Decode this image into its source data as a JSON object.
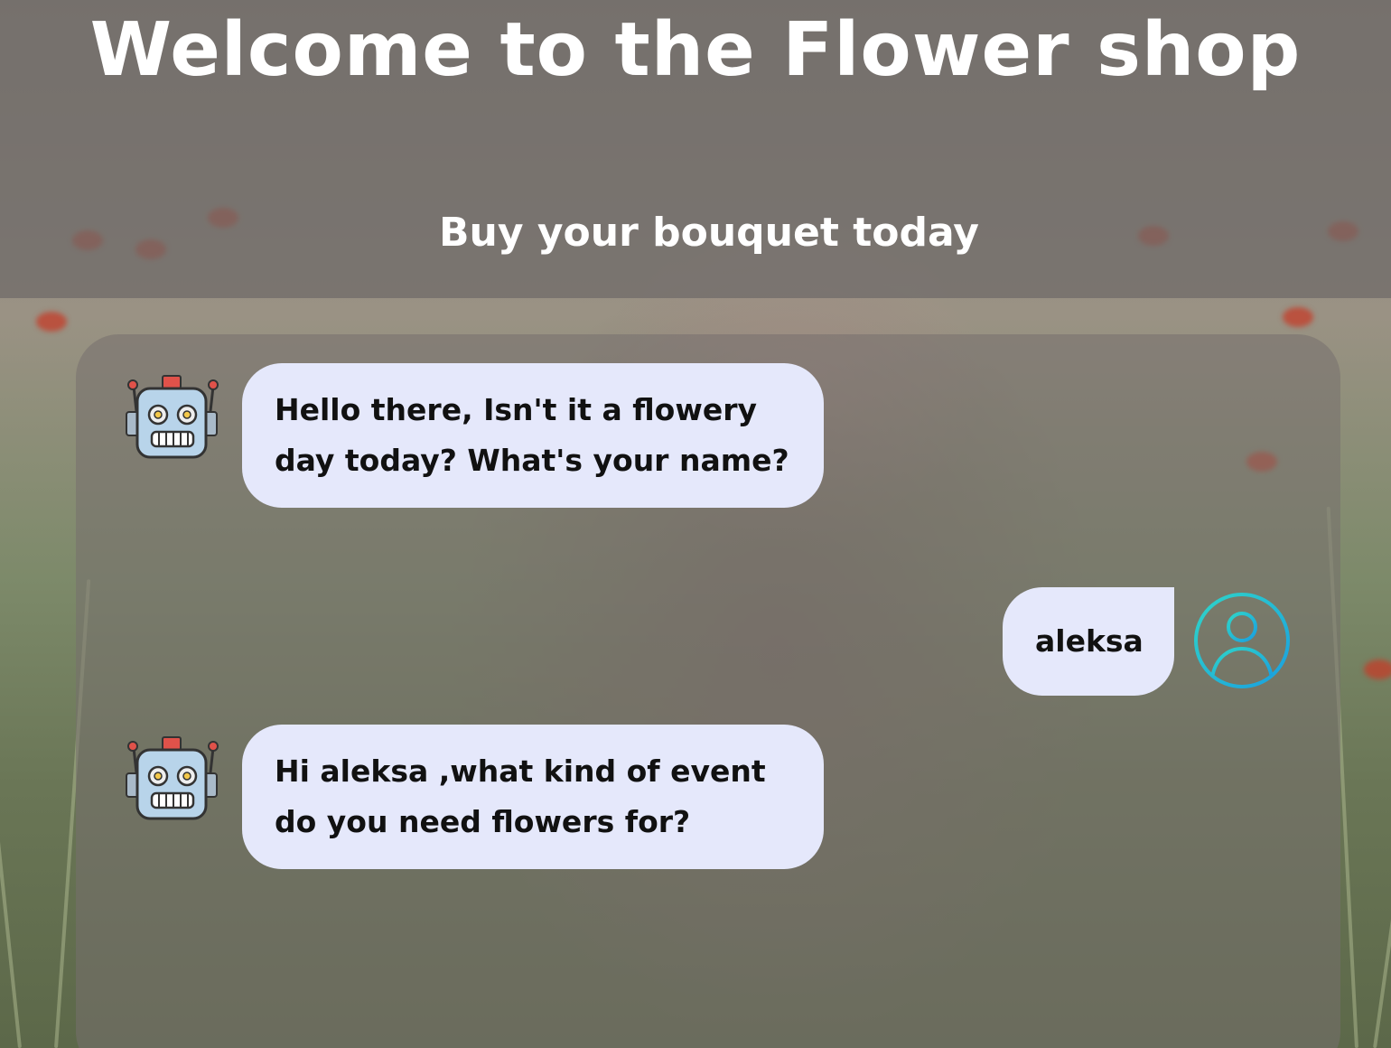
{
  "header": {
    "title": "Welcome to the Flower shop",
    "subtitle": "Buy your bouquet today"
  },
  "chat": {
    "messages": [
      {
        "sender": "bot",
        "text": "Hello there, Isn't it a flowery day today? What's your name?",
        "icon": "robot-icon"
      },
      {
        "sender": "user",
        "text": "aleksa",
        "icon": "user-circle-icon"
      },
      {
        "sender": "bot",
        "text": "Hi aleksa ,what kind of event do you need flowers for?",
        "icon": "robot-icon"
      }
    ]
  },
  "colors": {
    "bubble": "#e5e8fb",
    "user_icon_gradient_start": "#2fd5c8",
    "user_icon_gradient_end": "#1a9fe0",
    "header_overlay": "#6e6a68",
    "title_text": "#ffffff"
  }
}
